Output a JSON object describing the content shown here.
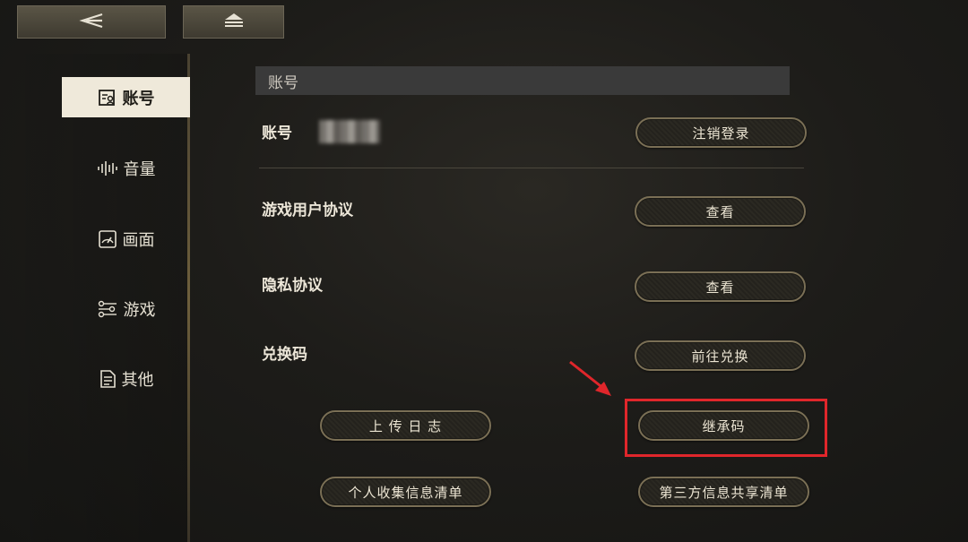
{
  "sidebar": {
    "items": [
      {
        "label": "账号",
        "icon": "account-doc-icon"
      },
      {
        "label": "音量",
        "icon": "soundwave-icon"
      },
      {
        "label": "画面",
        "icon": "gauge-icon"
      },
      {
        "label": "游戏",
        "icon": "sliders-icon"
      },
      {
        "label": "其他",
        "icon": "document-icon"
      }
    ]
  },
  "top_buttons": {
    "back_icon": "back-arrow-icon",
    "home_icon": "eject-icon"
  },
  "section": {
    "header": "账号"
  },
  "account": {
    "label": "账号",
    "logout_button": "注销登录"
  },
  "rows": [
    {
      "label": "游戏用户协议",
      "button": "查看"
    },
    {
      "label": "隐私协议",
      "button": "查看"
    },
    {
      "label": "兑换码",
      "button": "前往兑换"
    }
  ],
  "bottom_buttons": {
    "upload_log": "上 传 日 志",
    "inherit_code": "继承码",
    "personal_info_list": "个人收集信息清单",
    "third_party_list": "第三方信息共享清单"
  },
  "annotation": {
    "highlight_color": "#e0262b"
  }
}
